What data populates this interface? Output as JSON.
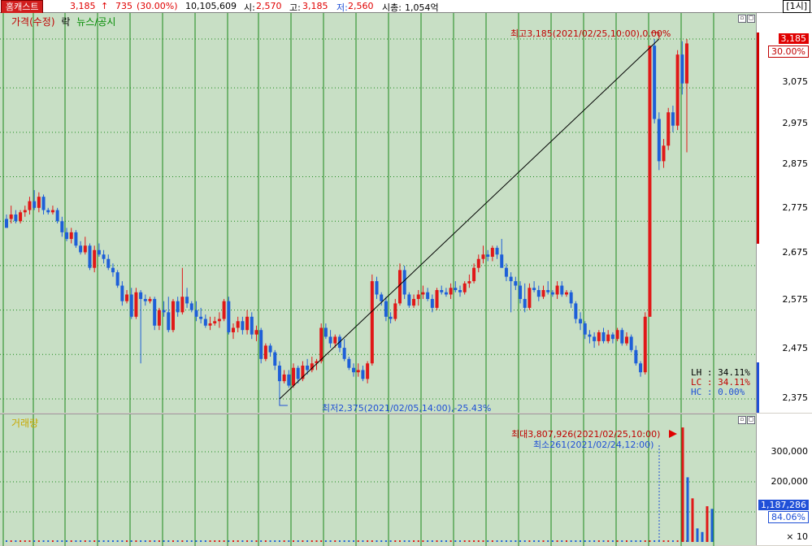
{
  "header": {
    "stock_name": "홈캐스트",
    "price": "3,185",
    "change_arrow": "↑",
    "change": "735",
    "change_pct": "(30.00%)",
    "volume": "10,105,609",
    "open_label": "시:",
    "open": "2,570",
    "high_label": "고:",
    "high": "3,185",
    "low_label": "저:",
    "low": "2,560",
    "cap_label": "시총:",
    "cap": "1,054억",
    "interval": "[1시]"
  },
  "price_pane": {
    "legend": [
      "가격(수정)",
      "락",
      "뉴스/공시"
    ],
    "high_annotation": "최고3,185(2021/02/25,10:00),0.00%",
    "low_annotation": "최저2,375(2021/02/05,14:00),-25.43%",
    "current_price_tag": "3,185",
    "current_pct_tag": "30.00%",
    "stats": [
      {
        "label": "LH",
        "value": "34.11%"
      },
      {
        "label": "LC",
        "value": "34.11%"
      },
      {
        "label": "HC",
        "value": "0.00%"
      }
    ],
    "ticks": [
      "3,075",
      "2,975",
      "2,875",
      "2,775",
      "2,675",
      "2,575",
      "2,475",
      "2,375"
    ],
    "colors": {
      "up": "#e01818",
      "down": "#1e5fd8",
      "background": "#c8dfc5",
      "gridline": "#1c8a1c"
    }
  },
  "volume_pane": {
    "legend": "거래량",
    "max_annotation": "최대3,807,926(2021/02/25,10:00)",
    "min_annotation": "최소261(2021/02/24,12:00)",
    "ticks": [
      "300,000",
      "200,000",
      "100,000"
    ],
    "current_tag": "1,187,286",
    "current_pct": "84.06%",
    "multiplier": "× 10"
  },
  "chart_data": {
    "type": "candlestick",
    "interval": "1h",
    "price_axis": {
      "min": 2375,
      "max": 3185,
      "ticks": [
        2375,
        2475,
        2575,
        2675,
        2775,
        2875,
        2975,
        3075
      ]
    },
    "high": {
      "value": 3185,
      "time": "2021/02/25,10:00"
    },
    "low": {
      "value": 2375,
      "time": "2021/02/05,14:00"
    },
    "candles": [
      [
        2780,
        2790,
        2770,
        2760
      ],
      [
        2780,
        2810,
        2770,
        2790
      ],
      [
        2790,
        2800,
        2770,
        2775
      ],
      [
        2775,
        2800,
        2770,
        2795
      ],
      [
        2795,
        2810,
        2785,
        2800
      ],
      [
        2800,
        2830,
        2790,
        2820
      ],
      [
        2820,
        2845,
        2800,
        2805
      ],
      [
        2805,
        2840,
        2795,
        2830
      ],
      [
        2830,
        2835,
        2790,
        2800
      ],
      [
        2800,
        2805,
        2790,
        2795
      ],
      [
        2795,
        2810,
        2790,
        2800
      ],
      [
        2800,
        2805,
        2770,
        2775
      ],
      [
        2775,
        2785,
        2740,
        2750
      ],
      [
        2750,
        2760,
        2730,
        2735
      ],
      [
        2735,
        2760,
        2725,
        2750
      ],
      [
        2750,
        2755,
        2715,
        2720
      ],
      [
        2720,
        2730,
        2700,
        2705
      ],
      [
        2705,
        2740,
        2700,
        2720
      ],
      [
        2720,
        2725,
        2665,
        2670
      ],
      [
        2670,
        2720,
        2660,
        2710
      ],
      [
        2710,
        2725,
        2695,
        2700
      ],
      [
        2700,
        2710,
        2680,
        2690
      ],
      [
        2690,
        2700,
        2665,
        2670
      ],
      [
        2670,
        2680,
        2650,
        2660
      ],
      [
        2660,
        2665,
        2625,
        2630
      ],
      [
        2630,
        2640,
        2585,
        2595
      ],
      [
        2595,
        2620,
        2590,
        2610
      ],
      [
        2610,
        2625,
        2555,
        2560
      ],
      [
        2560,
        2625,
        2555,
        2615
      ],
      [
        2615,
        2620,
        2455,
        2600
      ],
      [
        2600,
        2610,
        2585,
        2595
      ],
      [
        2595,
        2605,
        2590,
        2600
      ],
      [
        2600,
        2605,
        2530,
        2540
      ],
      [
        2540,
        2580,
        2530,
        2575
      ],
      [
        2575,
        2595,
        2560,
        2570
      ],
      [
        2570,
        2605,
        2525,
        2530
      ],
      [
        2530,
        2600,
        2525,
        2595
      ],
      [
        2595,
        2605,
        2560,
        2570
      ],
      [
        2570,
        2670,
        2565,
        2605
      ],
      [
        2605,
        2625,
        2580,
        2590
      ],
      [
        2590,
        2595,
        2570,
        2575
      ],
      [
        2575,
        2595,
        2550,
        2560
      ],
      [
        2560,
        2580,
        2545,
        2555
      ],
      [
        2555,
        2565,
        2535,
        2540
      ],
      [
        2540,
        2560,
        2530,
        2545
      ],
      [
        2545,
        2560,
        2540,
        2550
      ],
      [
        2550,
        2570,
        2535,
        2555
      ],
      [
        2555,
        2600,
        2550,
        2595
      ],
      [
        2595,
        2605,
        2520,
        2525
      ],
      [
        2525,
        2545,
        2510,
        2535
      ],
      [
        2535,
        2560,
        2525,
        2550
      ],
      [
        2550,
        2560,
        2520,
        2530
      ],
      [
        2530,
        2575,
        2520,
        2560
      ],
      [
        2560,
        2570,
        2510,
        2520
      ],
      [
        2520,
        2540,
        2505,
        2530
      ],
      [
        2530,
        2535,
        2455,
        2465
      ],
      [
        2465,
        2500,
        2460,
        2495
      ],
      [
        2495,
        2500,
        2470,
        2480
      ],
      [
        2480,
        2485,
        2440,
        2450
      ],
      [
        2450,
        2460,
        2375,
        2415
      ],
      [
        2415,
        2440,
        2410,
        2430
      ],
      [
        2430,
        2440,
        2400,
        2405
      ],
      [
        2405,
        2455,
        2400,
        2445
      ],
      [
        2445,
        2450,
        2410,
        2420
      ],
      [
        2420,
        2460,
        2415,
        2450
      ],
      [
        2450,
        2465,
        2430,
        2440
      ],
      [
        2440,
        2470,
        2435,
        2455
      ],
      [
        2455,
        2465,
        2440,
        2460
      ],
      [
        2460,
        2545,
        2455,
        2535
      ],
      [
        2535,
        2545,
        2510,
        2515
      ],
      [
        2515,
        2530,
        2490,
        2500
      ],
      [
        2500,
        2520,
        2490,
        2515
      ],
      [
        2515,
        2520,
        2480,
        2490
      ],
      [
        2490,
        2510,
        2460,
        2465
      ],
      [
        2465,
        2470,
        2440,
        2445
      ],
      [
        2445,
        2455,
        2425,
        2435
      ],
      [
        2435,
        2455,
        2425,
        2440
      ],
      [
        2440,
        2450,
        2415,
        2420
      ],
      [
        2420,
        2460,
        2410,
        2455
      ],
      [
        2455,
        2655,
        2450,
        2640
      ],
      [
        2640,
        2650,
        2600,
        2610
      ],
      [
        2610,
        2615,
        2585,
        2595
      ],
      [
        2595,
        2605,
        2550,
        2560
      ],
      [
        2560,
        2570,
        2545,
        2555
      ],
      [
        2555,
        2600,
        2550,
        2590
      ],
      [
        2590,
        2680,
        2585,
        2665
      ],
      [
        2665,
        2675,
        2600,
        2610
      ],
      [
        2610,
        2615,
        2580,
        2585
      ],
      [
        2585,
        2610,
        2580,
        2600
      ],
      [
        2600,
        2620,
        2585,
        2610
      ],
      [
        2610,
        2630,
        2600,
        2615
      ],
      [
        2615,
        2625,
        2595,
        2600
      ],
      [
        2600,
        2610,
        2570,
        2580
      ],
      [
        2580,
        2625,
        2575,
        2620
      ],
      [
        2620,
        2630,
        2610,
        2615
      ],
      [
        2615,
        2625,
        2605,
        2610
      ],
      [
        2610,
        2635,
        2600,
        2625
      ],
      [
        2625,
        2640,
        2615,
        2620
      ],
      [
        2620,
        2630,
        2605,
        2615
      ],
      [
        2615,
        2640,
        2610,
        2635
      ],
      [
        2635,
        2655,
        2625,
        2640
      ],
      [
        2640,
        2680,
        2635,
        2670
      ],
      [
        2670,
        2700,
        2660,
        2690
      ],
      [
        2690,
        2720,
        2680,
        2700
      ],
      [
        2700,
        2710,
        2685,
        2695
      ],
      [
        2695,
        2720,
        2685,
        2715
      ],
      [
        2715,
        2720,
        2690,
        2700
      ],
      [
        2700,
        2735,
        2690,
        2670
      ],
      [
        2670,
        2680,
        2640,
        2650
      ],
      [
        2650,
        2660,
        2570,
        2640
      ],
      [
        2640,
        2650,
        2620,
        2630
      ],
      [
        2630,
        2640,
        2590,
        2600
      ],
      [
        2600,
        2635,
        2570,
        2580
      ],
      [
        2580,
        2635,
        2575,
        2625
      ],
      [
        2625,
        2640,
        2615,
        2620
      ],
      [
        2620,
        2630,
        2595,
        2605
      ],
      [
        2605,
        2630,
        2600,
        2620
      ],
      [
        2620,
        2640,
        2610,
        2615
      ],
      [
        2615,
        2620,
        2605,
        2610
      ],
      [
        2610,
        2640,
        2600,
        2630
      ],
      [
        2630,
        2640,
        2605,
        2610
      ],
      [
        2610,
        2620,
        2605,
        2615
      ],
      [
        2615,
        2620,
        2580,
        2590
      ],
      [
        2590,
        2595,
        2545,
        2555
      ],
      [
        2555,
        2570,
        2530,
        2545
      ],
      [
        2545,
        2550,
        2510,
        2520
      ],
      [
        2520,
        2530,
        2500,
        2515
      ],
      [
        2515,
        2525,
        2490,
        2505
      ],
      [
        2505,
        2530,
        2495,
        2525
      ],
      [
        2525,
        2535,
        2500,
        2505
      ],
      [
        2505,
        2530,
        2500,
        2520
      ],
      [
        2520,
        2525,
        2500,
        2510
      ],
      [
        2510,
        2535,
        2505,
        2530
      ],
      [
        2530,
        2535,
        2495,
        2500
      ],
      [
        2500,
        2525,
        2495,
        2515
      ],
      [
        2515,
        2520,
        2480,
        2485
      ],
      [
        2485,
        2495,
        2450,
        2455
      ],
      [
        2455,
        2460,
        2425,
        2435
      ],
      [
        2435,
        2570,
        2430,
        2560
      ],
      [
        2560,
        2575,
        3115,
        3170
      ],
      [
        3170,
        3185,
        2995,
        3005
      ],
      [
        3005,
        3020,
        2890,
        2910
      ],
      [
        2910,
        2960,
        2895,
        2945
      ],
      [
        2945,
        3030,
        2935,
        3020
      ],
      [
        3020,
        3035,
        2975,
        2990
      ],
      [
        2990,
        3160,
        2980,
        3150
      ],
      [
        3150,
        3180,
        3060,
        3085
      ],
      [
        3085,
        3185,
        2930,
        3175
      ]
    ],
    "candle_note": "each candle = [open, high, low, close], approximate; last candles spike",
    "volume_axis": {
      "ticks": [
        100000,
        200000,
        300000
      ],
      "multiplier": 10
    },
    "volume_max": {
      "value": 3807926,
      "time": "2021/02/25,10:00"
    },
    "volume_min": {
      "value": 261,
      "time": "2021/02/24,12:00"
    },
    "current_volume": 1187286,
    "volume_spikes": [
      {
        "index": 147,
        "value": 380792
      },
      {
        "index": 148,
        "value": 215000
      },
      {
        "index": 149,
        "value": 145000
      },
      {
        "index": 150,
        "value": 45000
      },
      {
        "index": 151,
        "value": 33000
      },
      {
        "index": 152,
        "value": 118728
      },
      {
        "index": 153,
        "value": 110000
      }
    ]
  }
}
